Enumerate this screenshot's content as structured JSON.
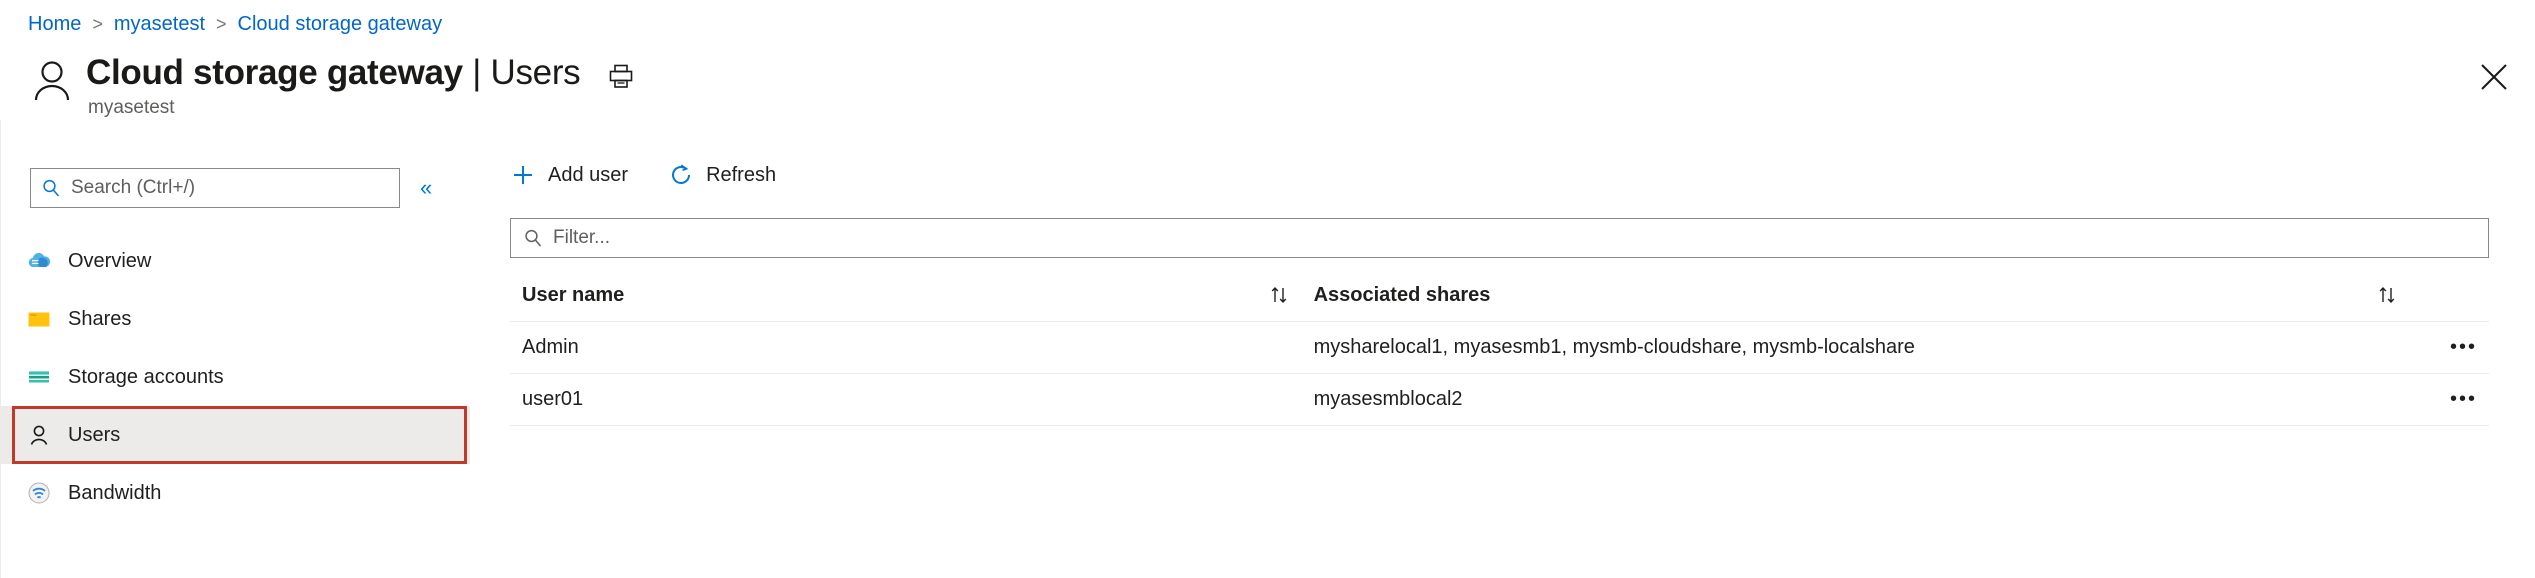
{
  "breadcrumb": {
    "items": [
      {
        "label": "Home"
      },
      {
        "label": "myasetest"
      },
      {
        "label": "Cloud storage gateway"
      }
    ],
    "separator": ">"
  },
  "header": {
    "title_main": "Cloud storage gateway",
    "title_section": " | Users",
    "subtitle": "myasetest",
    "page_icon": "user-icon",
    "print_icon": "print-icon",
    "close_icon": "close-icon"
  },
  "sidebar": {
    "search": {
      "placeholder": "Search (Ctrl+/)",
      "value": "",
      "icon": "search-icon"
    },
    "collapse_label": "«",
    "items": [
      {
        "label": "Overview",
        "icon": "cloud-icon",
        "selected": false
      },
      {
        "label": "Shares",
        "icon": "folder-icon",
        "selected": false
      },
      {
        "label": "Storage accounts",
        "icon": "storage-account-icon",
        "selected": false
      },
      {
        "label": "Users",
        "icon": "user-icon",
        "selected": true
      },
      {
        "label": "Bandwidth",
        "icon": "bandwidth-icon",
        "selected": false
      }
    ],
    "highlight_color": "#c0392b"
  },
  "toolbar": {
    "add_user_label": "Add user",
    "add_user_icon": "plus-icon",
    "refresh_label": "Refresh",
    "refresh_icon": "refresh-icon"
  },
  "filter": {
    "placeholder": "Filter...",
    "value": "",
    "icon": "search-icon"
  },
  "table": {
    "columns": [
      {
        "label": "User name",
        "sort_icon": "sort-icon"
      },
      {
        "label": "Associated shares",
        "sort_icon": "sort-icon"
      }
    ],
    "rows": [
      {
        "user_name": "Admin",
        "associated_shares": "mysharelocal1, myasesmb1, mysmb-cloudshare, mysmb-localshare",
        "menu": "•••"
      },
      {
        "user_name": "user01",
        "associated_shares": "myasesmblocal2",
        "menu": "•••"
      }
    ]
  },
  "colors": {
    "link": "#0066cc",
    "accent": "#0078d4",
    "selected_row_bg": "#edebe9",
    "annotation": "#c0392b"
  }
}
